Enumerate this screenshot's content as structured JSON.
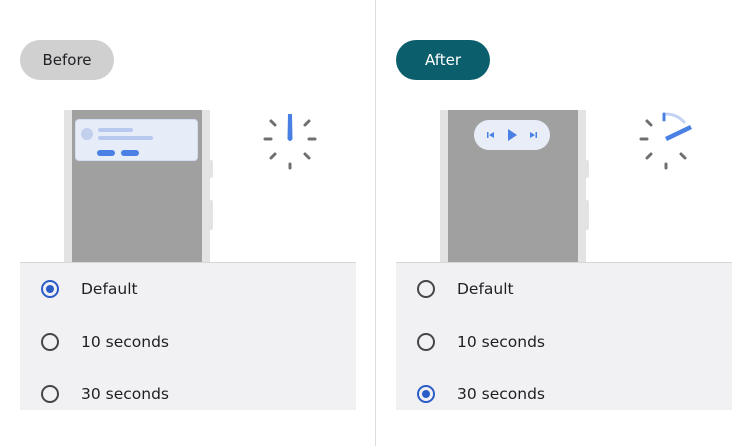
{
  "colors": {
    "accent_blue": "#2b5dc9",
    "after_pill": "#0b5e6b",
    "before_pill": "#d0d0d0",
    "phone_screen": "#a0a0a0",
    "options_bg": "#f1f1f4"
  },
  "before": {
    "badge": "Before",
    "illustration": {
      "notification": "notification-card",
      "timer_icon": "timer-icon"
    },
    "options": [
      {
        "label": "Default",
        "selected": true
      },
      {
        "label": "10 seconds",
        "selected": false
      },
      {
        "label": "30 seconds",
        "selected": false
      }
    ]
  },
  "after": {
    "badge": "After",
    "illustration": {
      "media_controls": [
        "previous-icon",
        "play-icon",
        "next-icon"
      ],
      "timer_icon": "timer-icon"
    },
    "options": [
      {
        "label": "Default",
        "selected": false
      },
      {
        "label": "10 seconds",
        "selected": false
      },
      {
        "label": "30 seconds",
        "selected": true
      }
    ]
  }
}
